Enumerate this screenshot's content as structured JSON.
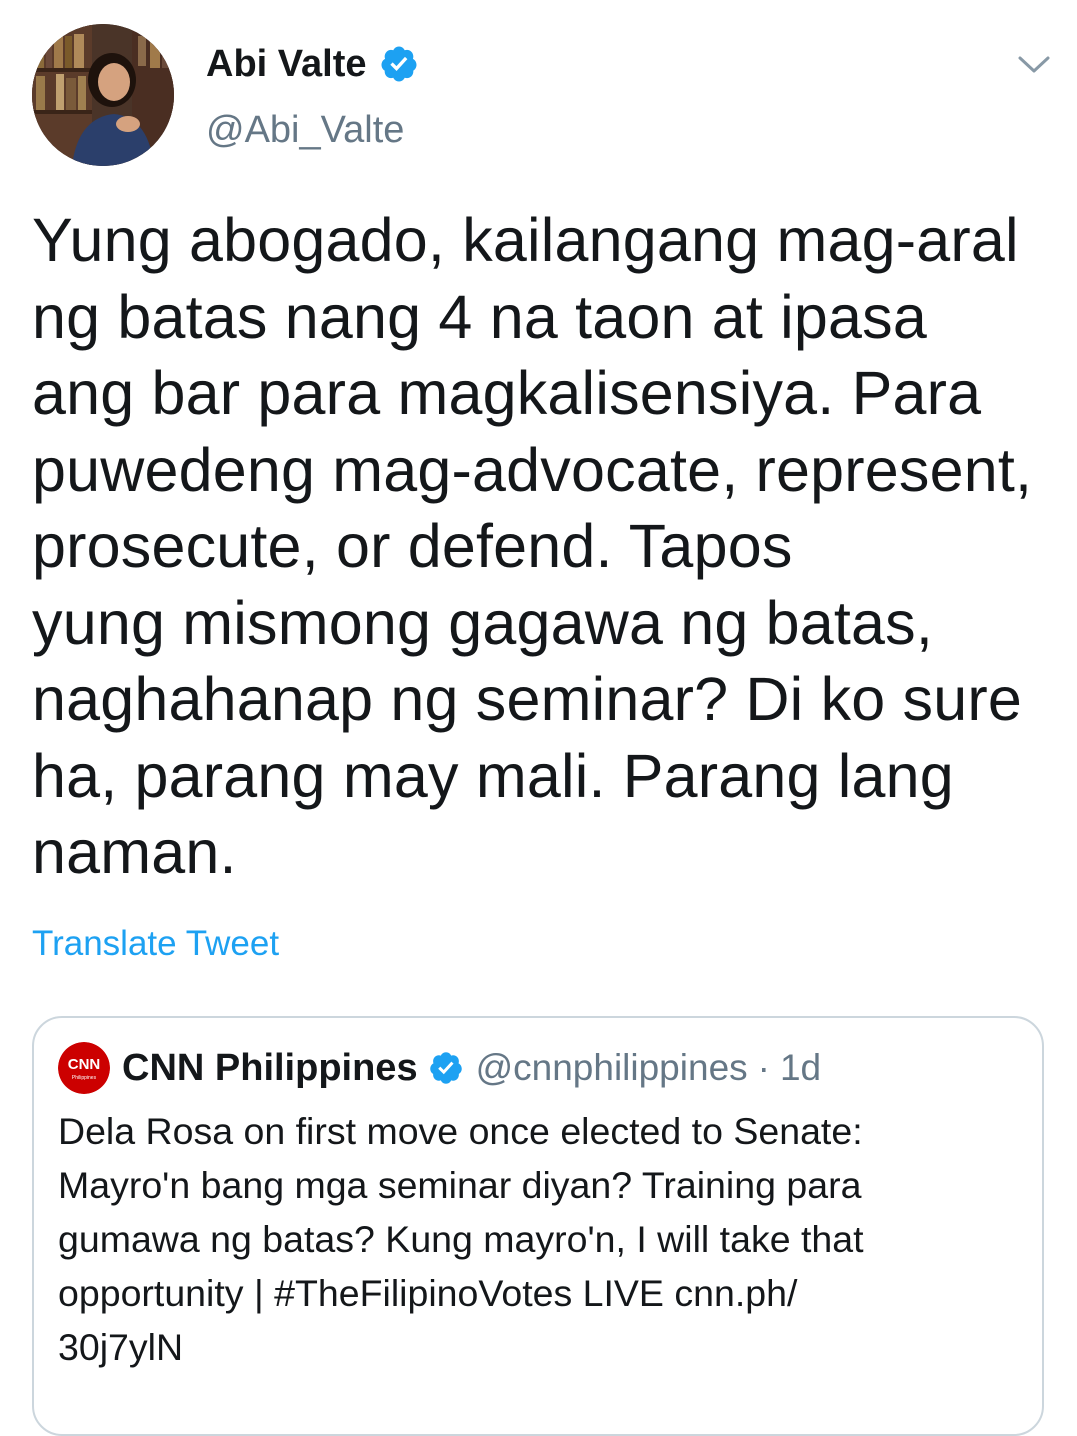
{
  "author": {
    "display_name": "Abi Valte",
    "handle": "@Abi_Valte",
    "verified": true,
    "avatar_icon": "profile-photo"
  },
  "tweet": {
    "text": "Yung abogado, kailangang mag-aral\nng batas nang 4 na taon at ipasa\nang bar para magkalisensiya. Para\npuwedeng mag-advocate, represent,\nprosecute, or defend. Tapos\nyung mismong gagawa ng batas,\nnaghahanap ng seminar? Di ko sure\nha, parang may mali. Parang lang\nnaman.",
    "translate_label": "Translate Tweet",
    "menu_icon": "chevron-down-icon"
  },
  "quoted_tweet": {
    "display_name": "CNN Philippines",
    "handle": "@cnnphilippines",
    "separator": "·",
    "time": "1d",
    "verified": true,
    "logo_icon": "cnn-philippines-logo",
    "text": "Dela Rosa on first move once elected to Senate:\nMayro'n bang mga seminar diyan? Training para\ngumawa ng batas? Kung mayro'n, I will take that\nopportunity | #TheFilipinoVotes LIVE cnn.ph/\n30j7ylN"
  },
  "colors": {
    "text_primary": "#14171a",
    "text_secondary": "#657786",
    "link": "#1da1f2",
    "verified_badge": "#1da1f2",
    "border": "#ccd6dd",
    "cnn_red": "#cc0000"
  }
}
